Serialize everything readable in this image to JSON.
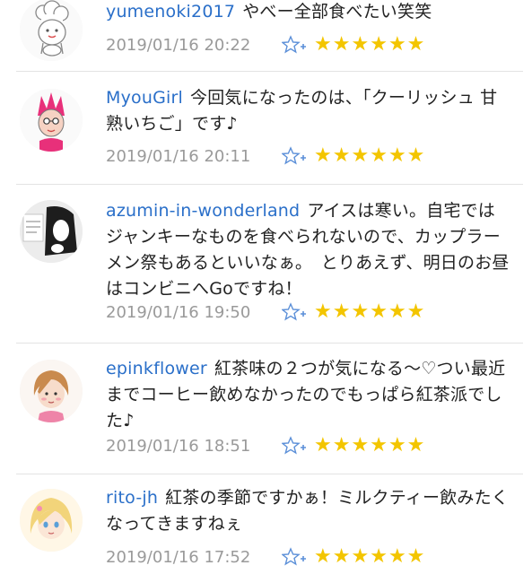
{
  "comments": [
    {
      "user": "yumenoki2017",
      "text": "やべー全部食べたい笑笑",
      "date": "2019/01/16 20:22",
      "stars": [
        "★",
        "★",
        "★",
        "★",
        "★",
        "★"
      ]
    },
    {
      "user": "MyouGirl",
      "text": "今回気になったのは、「クーリッシュ 甘熟いちご」です♪",
      "date": "2019/01/16 20:11",
      "stars": [
        "★",
        "★",
        "★",
        "★",
        "★",
        "★"
      ]
    },
    {
      "user": "azumin-in-wonderland",
      "text": "アイスは寒い。自宅ではジャンキーなものを食べられないので、カップラーメン祭もあるといいなぁ。　とりあえず、明日のお昼はコンビニへGoですね！",
      "date": "2019/01/16 19:50",
      "stars": [
        "★",
        "★",
        "★",
        "★",
        "★",
        "★"
      ]
    },
    {
      "user": "epinkflower",
      "text": "紅茶味の２つが気になる〜♡つい最近までコーヒー飲めなかったのでもっぱら紅茶派でした♪",
      "date": "2019/01/16 18:51",
      "stars": [
        "★",
        "★",
        "★",
        "★",
        "★",
        "★"
      ]
    },
    {
      "user": "rito-jh",
      "text": "紅茶の季節ですかぁ！ミルクティー飲みたくなってきますねぇ",
      "date": "2019/01/16 17:52",
      "stars": [
        "★",
        "★",
        "★",
        "★",
        "★",
        "★"
      ]
    }
  ],
  "colors": {
    "username": "#2a6fc9",
    "star": "#f3c500",
    "date": "#9a9a9a",
    "divider": "#e3e3e3"
  },
  "icons": {
    "favorite_add": "star-plus-icon",
    "rating": "star-icon"
  }
}
